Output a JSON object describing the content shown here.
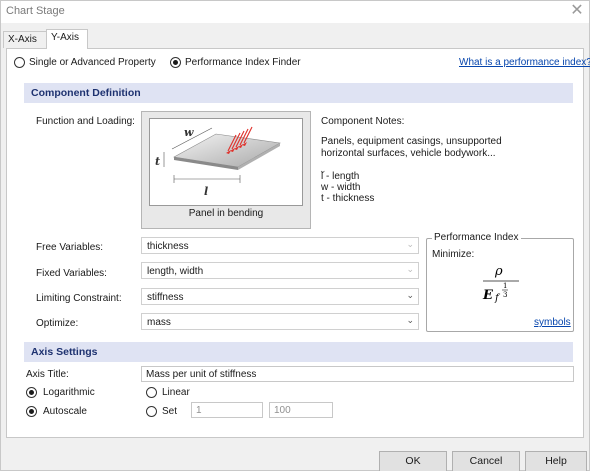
{
  "window": {
    "title": "Chart Stage",
    "close_glyph": "✕"
  },
  "tabs": [
    {
      "label": "X-Axis",
      "active": false
    },
    {
      "label": "Y-Axis",
      "active": true
    }
  ],
  "mode": {
    "options": [
      "Single or Advanced Property",
      "Performance Index Finder"
    ],
    "selected": "Performance Index Finder",
    "help_link": "What is a performance index?"
  },
  "component": {
    "section_title": "Component Definition",
    "function_label": "Function and Loading:",
    "figure": {
      "caption": "Panel in bending",
      "w": "w",
      "t": "t",
      "l": "l"
    },
    "notes_title": "Component Notes:",
    "notes_text": "Panels, equipment casings, unsupported horizontal surfaces, vehicle bodywork...",
    "legend_l": "l - length",
    "legend_w": "w - width",
    "legend_t": "t - thickness",
    "free_label": "Free Variables:",
    "free_value": "thickness",
    "fixed_label": "Fixed Variables:",
    "fixed_value": "length, width",
    "constraint_label": "Limiting Constraint:",
    "constraint_value": "stiffness",
    "optimize_label": "Optimize:",
    "optimize_value": "mass"
  },
  "performance_index": {
    "legend": "Performance Index",
    "minimize": "Minimize:",
    "numerator": "ρ",
    "denominator": "E",
    "subscript": "f",
    "exp_num": "1",
    "exp_den": "3",
    "symbols_link": "symbols"
  },
  "axis": {
    "section_title": "Axis Settings",
    "title_label": "Axis Title:",
    "title_value": "Mass per unit of stiffness",
    "scale_options": [
      "Logarithmic",
      "Linear"
    ],
    "scale_selected": "Logarithmic",
    "range_options": [
      "Autoscale",
      "Set"
    ],
    "range_selected": "Autoscale",
    "min": "1",
    "max": "100"
  },
  "buttons": {
    "ok": "OK",
    "cancel": "Cancel",
    "help": "Help"
  },
  "colors": {
    "section_bg": "#dfe3f3",
    "section_text": "#1e3270",
    "link": "#0645ad",
    "arrow": "#e0302a"
  },
  "icons": {
    "dropdown": "chevron-down-icon",
    "close": "close-icon"
  }
}
